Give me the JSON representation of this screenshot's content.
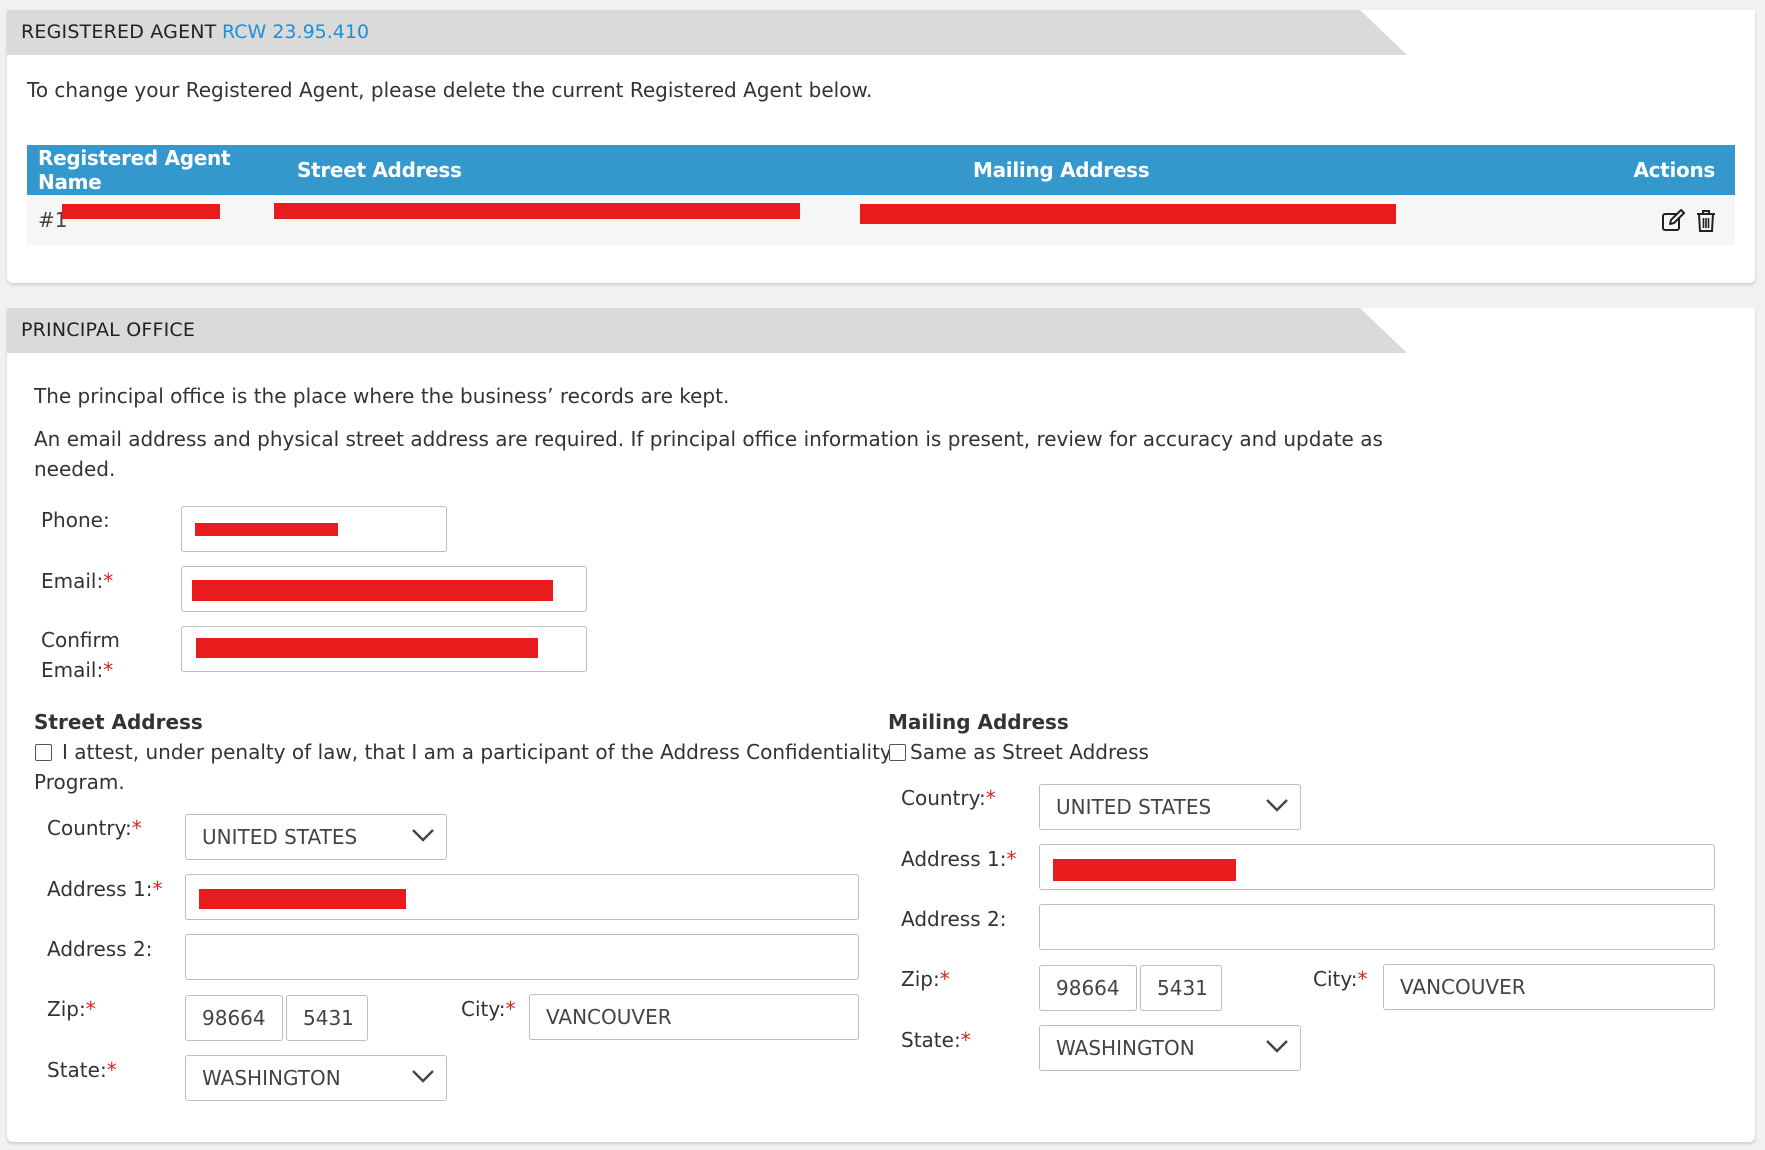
{
  "registered_agent": {
    "header_title": "REGISTERED AGENT",
    "rcw_link": "RCW 23.95.410",
    "instruction": "To change your Registered Agent, please delete the current Registered Agent below.",
    "columns": [
      "Registered Agent Name",
      "Street Address",
      "Mailing Address",
      "Actions"
    ],
    "rows": [
      {
        "index_label": "#1"
      }
    ]
  },
  "principal_office": {
    "header_title": "PRINCIPAL OFFICE",
    "intro_1": "The principal office is the place where the business’ records are kept.",
    "intro_2a": "An email address and physical street address are required. If principal office information is present, review for accuracy and update as",
    "intro_2b": "needed.",
    "phone_label": "Phone:",
    "email_label": "Email:",
    "confirm_label_1": "Confirm",
    "confirm_label_2": "Email:",
    "required_mark": "*",
    "street": {
      "heading": "Street Address",
      "attest_1": "I attest, under penalty of law, that I am a participant of the Address Confidentiality",
      "attest_2": "Program.",
      "country_label": "Country:",
      "country_value": "UNITED STATES",
      "address1_label": "Address 1:",
      "address2_label": "Address 2:",
      "address2_value": "",
      "zip_label": "Zip:",
      "zip_value": "98664",
      "zip4_value": "5431",
      "city_label": "City:",
      "city_value": "VANCOUVER",
      "state_label": "State:",
      "state_value": "WASHINGTON"
    },
    "mailing": {
      "heading": "Mailing Address",
      "same_as": "Same as Street Address",
      "country_label": "Country:",
      "country_value": "UNITED STATES",
      "address1_label": "Address 1:",
      "address2_label": "Address 2:",
      "address2_value": "",
      "zip_label": "Zip:",
      "zip_value": "98664",
      "zip4_value": "5431",
      "city_label": "City:",
      "city_value": "VANCOUVER",
      "state_label": "State:",
      "state_value": "WASHINGTON"
    }
  },
  "colors": {
    "table_header": "#3598cd",
    "link": "#1e90d8",
    "required": "#d9251d",
    "redaction": "#e81c1c"
  },
  "icons": [
    "edit-icon",
    "trash-icon",
    "chevron-down-icon"
  ]
}
